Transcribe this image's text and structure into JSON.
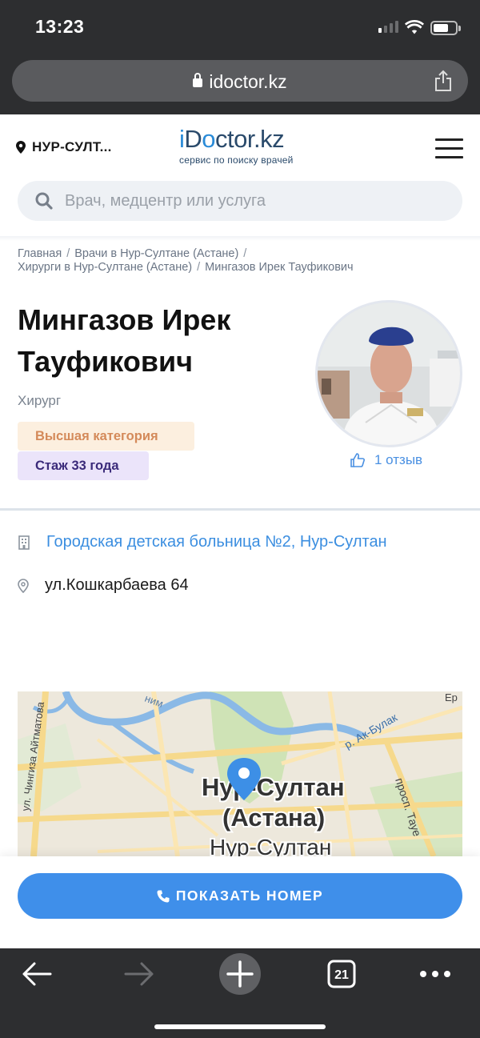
{
  "status_bar": {
    "time": "13:23",
    "signal_bars_active": 1
  },
  "browser": {
    "url": "idoctor.kz",
    "tab_count": "21"
  },
  "header": {
    "city": "НУР-СУЛТ...",
    "logo_i": "i",
    "logo_d": "D",
    "logo_o": "o",
    "logo_rest": "ctor.kz",
    "logo_tagline": "сервис по поиску врачей",
    "search_placeholder": "Врач, медцентр или услуга"
  },
  "breadcrumb": [
    "Главная",
    "Врачи в Нур-Султане (Астане)",
    "Хирурги в Нур-Султане (Астане)",
    "Мингазов Ирек Тауфикович"
  ],
  "doctor": {
    "name": "Мингазов Ирек Тауфикович",
    "specialty": "Хирург",
    "category_badge": "Высшая категория",
    "experience_badge": "Стаж 33 года",
    "reviews": "1 отзыв"
  },
  "location": {
    "clinic": "Городская детская больница №2, Нур-Султан",
    "address": "ул.Кошкарбаева 64"
  },
  "map": {
    "label_city": "Нур-Султан",
    "label_astana": "(Астана)",
    "label_city2": "Нур-Султан",
    "label_street_aitmatov": "ул. Чингиза Айтматова",
    "label_river": "р. Ак-Булак",
    "label_avenue": "просп. Тауе",
    "label_partial_top": "ним",
    "label_partial_right": "Ер"
  },
  "cta": {
    "show_phone": "ПОКАЗАТЬ НОМЕР"
  },
  "colors": {
    "chrome": "#2d2e30",
    "accent": "#3f8fea",
    "link": "#3b8ee0",
    "badge_category_bg": "#fcefdf",
    "badge_category_fg": "#d48a5a",
    "badge_experience_bg": "#ebe4fa",
    "badge_experience_fg": "#3a2a7a"
  }
}
